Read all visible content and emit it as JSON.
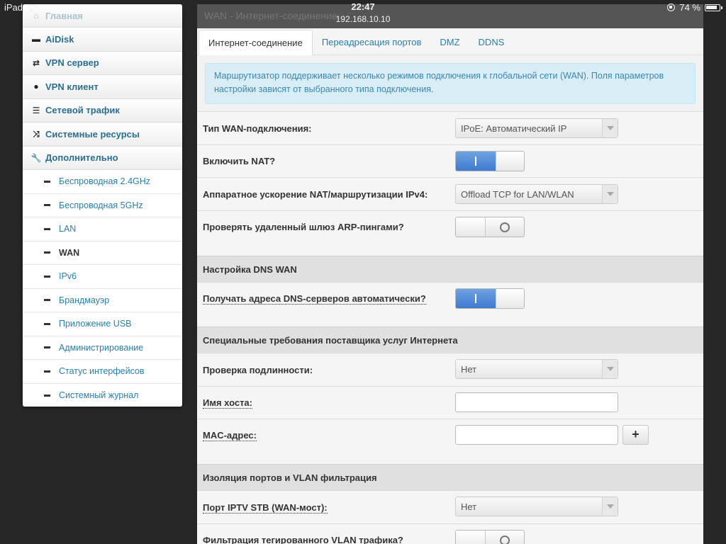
{
  "status": {
    "device": "iPad",
    "time": "22:47",
    "url": "192.168.10.10",
    "battery": "74 %"
  },
  "sidebar": {
    "top_faded": "Главная",
    "items": [
      {
        "label": "AiDisk",
        "icon": "hdd-icon"
      },
      {
        "label": "VPN сервер",
        "icon": "retweet-icon"
      },
      {
        "label": "VPN клиент",
        "icon": "globe-icon"
      },
      {
        "label": "Сетевой трафик",
        "icon": "tasks-icon"
      },
      {
        "label": "Системные ресурсы",
        "icon": "random-icon"
      },
      {
        "label": "Дополнительно",
        "icon": "wrench-icon"
      }
    ],
    "subitems": [
      "Беспроводная 2.4GHz",
      "Беспроводная 5GHz",
      "LAN",
      "WAN",
      "IPv6",
      "Брандмауэр",
      "Приложение USB",
      "Администрирование",
      "Статус интерфейсов",
      "Системный журнал"
    ],
    "active_subitem": "WAN"
  },
  "main": {
    "header": "WAN - Интернет-соединение",
    "tabs": [
      "Интернет-соединение",
      "Переадресация портов",
      "DMZ",
      "DDNS"
    ],
    "active_tab": "Интернет-соединение",
    "info": "Маршрутизатор поддерживает несколько режимов подключения к глобальной сети (WAN). Поля параметров настройки зависят от выбранного типа подключения.",
    "fields": {
      "wan_type_label": "Тип WAN-подключения:",
      "wan_type_value": "IPoE: Автоматический IP",
      "nat_label": "Включить NAT?",
      "hw_nat_label": "Аппаратное ускорение NAT/маршрутизации IPv4:",
      "hw_nat_value": "Offload TCP for LAN/WLAN",
      "arp_label": "Проверять удаленный шлюз ARP-пингами?",
      "dns_section": "Настройка DNS WAN",
      "dns_auto_label": "Получать адреса DNS-серверов автоматически?",
      "isp_section": "Специальные требования поставщика услуг Интернета",
      "auth_label": "Проверка подлинности:",
      "auth_value": "Нет",
      "hostname_label": "Имя хоста:",
      "mac_label": "MAC-адрес:",
      "mac_add": "+",
      "vlan_section": "Изоляция портов и VLAN фильтрация",
      "iptv_label": "Порт IPTV STB (WAN-мост):",
      "iptv_value": "Нет",
      "vlan_filter_label": "Фильтрация тегированного VLAN трафика?"
    },
    "toggles": {
      "nat": true,
      "arp": false,
      "dns_auto": true,
      "vlan_filter": false
    }
  }
}
